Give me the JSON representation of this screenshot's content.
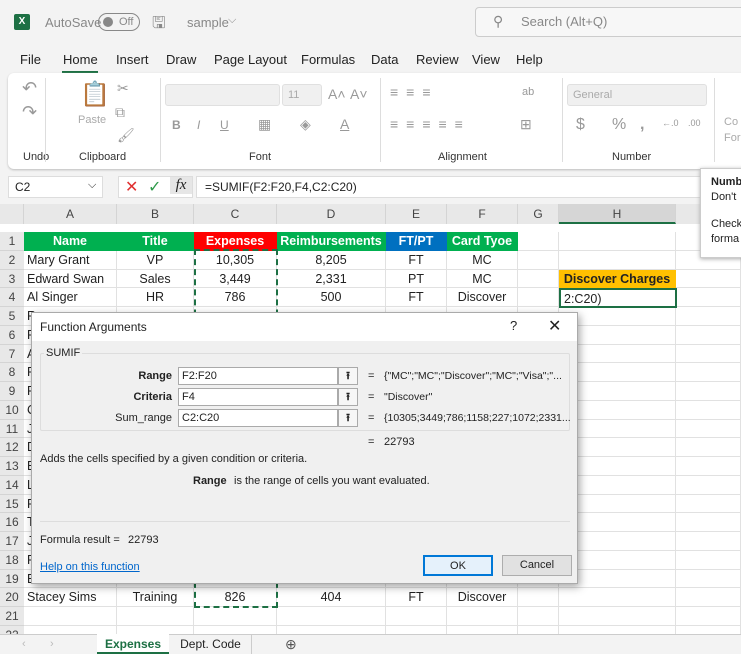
{
  "titlebar": {
    "autosave": "AutoSave",
    "toggle": "Off",
    "filename": "sample",
    "search_placeholder": "Search (Alt+Q)"
  },
  "menu": [
    "File",
    "Home",
    "Insert",
    "Draw",
    "Page Layout",
    "Formulas",
    "Data",
    "Review",
    "View",
    "Help"
  ],
  "ribbon": {
    "groups": [
      "Undo",
      "Clipboard",
      "Font",
      "Alignment",
      "Number"
    ],
    "paste": "Paste",
    "font_size": "11",
    "number_format": "General",
    "cond_format": "Co For"
  },
  "formula_bar": {
    "name_box": "C2",
    "formula": "=SUMIF(F2:F20,F4,C2:C20)"
  },
  "tooltip": {
    "title": "Numb",
    "line1": "Don't",
    "line2": "Check",
    "line3": "forma"
  },
  "columns": [
    "A",
    "B",
    "C",
    "D",
    "E",
    "F",
    "G",
    "H"
  ],
  "rows": {
    "header": [
      "Name",
      "Title",
      "Expenses",
      "Reimbursements",
      "FT/PT",
      "Card Tyoe"
    ],
    "data": [
      [
        "Mary Grant",
        "VP",
        "10,305",
        "8,205",
        "FT",
        "MC"
      ],
      [
        "Edward Swan",
        "Sales",
        "3,449",
        "2,331",
        "PT",
        "MC"
      ],
      [
        "Al Singer",
        "HR",
        "786",
        "500",
        "FT",
        "Discover"
      ]
    ],
    "partial_a": [
      "R",
      "R",
      "A",
      "P",
      "R",
      "C",
      "J",
      "D",
      "E",
      "L",
      "P",
      "T",
      "J",
      "P",
      "E"
    ],
    "row20": [
      "Stacey Sims",
      "Training",
      "826",
      "404",
      "FT",
      "Discover"
    ]
  },
  "header_colors": {
    "green": "#00b050",
    "red": "#ff0000",
    "blue": "#0070c0",
    "gold": "#ffc000"
  },
  "h3_label": "Discover Charges",
  "h4_edit": "2:C20)",
  "dialog": {
    "title": "Function Arguments",
    "help": "?",
    "function": "SUMIF",
    "args": [
      {
        "label": "Range",
        "value": "F2:F20",
        "result": "{\"MC\";\"MC\";\"Discover\";\"MC\";\"Visa\";\"..."
      },
      {
        "label": "Criteria",
        "value": "F4",
        "result": "\"Discover\""
      },
      {
        "label": "Sum_range",
        "value": "C2:C20",
        "result": "{10305;3449;786;1158;227;1072;2331..."
      }
    ],
    "total": "22793",
    "description": "Adds the cells specified by a given condition or criteria.",
    "arg_name": "Range",
    "arg_desc": "is the range of cells you want evaluated.",
    "formula_result_label": "Formula result =",
    "formula_result": "22793",
    "help_link": "Help on this function",
    "ok": "OK",
    "cancel": "Cancel"
  },
  "sheets": [
    "Expenses",
    "Dept. Code"
  ],
  "active_sheet": "Expenses"
}
